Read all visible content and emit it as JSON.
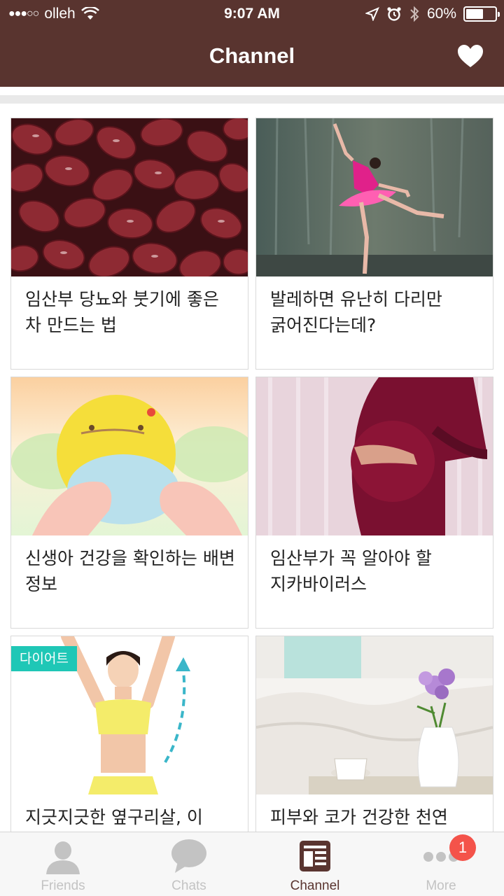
{
  "status_bar": {
    "signal": "●●●○○",
    "carrier": "olleh",
    "time": "9:07 AM",
    "battery_percent": "60%",
    "battery_level": 0.6,
    "icons": [
      "wifi-icon",
      "location-icon",
      "alarm-icon",
      "bluetooth-icon",
      "battery-icon"
    ]
  },
  "header": {
    "title": "Channel",
    "favorite_icon": "heart-icon"
  },
  "cards": [
    {
      "title": "임산부 당뇨와 붓기에 좋은 차 만드는 법",
      "image": "red-beans-photo",
      "badge": ""
    },
    {
      "title": "발레하면 유난히 다리만 굵어진다는데?",
      "image": "ballerina-photo",
      "badge": ""
    },
    {
      "title": "신생아 건강을 확인하는 배변 정보",
      "image": "baby-diaper-illustration",
      "badge": ""
    },
    {
      "title": "임산부가 꼭 알아야 할 지카바이러스",
      "image": "pregnant-woman-photo",
      "badge": ""
    },
    {
      "title": "지긋지긋한 옆구리살, 이",
      "image": "stretching-woman-photo",
      "badge": "다이어트"
    },
    {
      "title": "피부와 코가 건강한 천연",
      "image": "bedroom-flowers-photo",
      "badge": ""
    }
  ],
  "tabs": [
    {
      "label": "Friends",
      "icon": "person-icon",
      "active": false
    },
    {
      "label": "Chats",
      "icon": "chat-bubble-icon",
      "active": false
    },
    {
      "label": "Channel",
      "icon": "channel-icon",
      "active": true
    },
    {
      "label": "More",
      "icon": "more-dots-icon",
      "active": false
    }
  ],
  "more_badge": "1",
  "colors": {
    "header_bg": "#59342f",
    "badge_teal": "#1fc7b6",
    "notification_red": "#f4534a",
    "tab_inactive": "#c3c3c3"
  }
}
